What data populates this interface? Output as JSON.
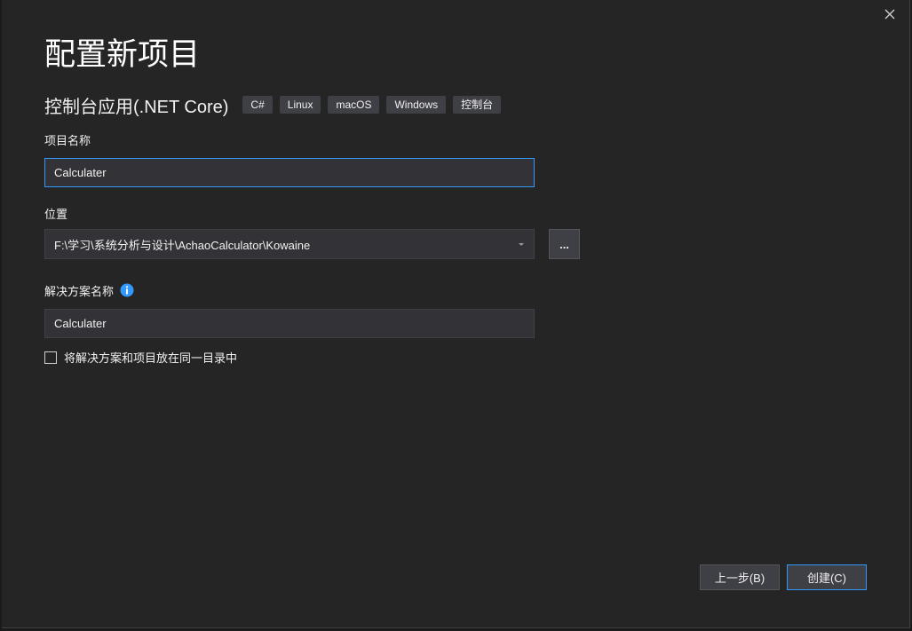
{
  "dialog": {
    "title": "配置新项目",
    "template_name": "控制台应用(.NET Core)",
    "tags": [
      "C#",
      "Linux",
      "macOS",
      "Windows",
      "控制台"
    ]
  },
  "project_name": {
    "label": "项目名称",
    "value": "Calculater"
  },
  "location": {
    "label": "位置",
    "value": "F:\\学习\\系统分析与设计\\AchaoCalculator\\Kowaine",
    "browse_label": "..."
  },
  "solution_name": {
    "label": "解决方案名称",
    "value": "Calculater"
  },
  "same_directory": {
    "label": "将解决方案和项目放在同一目录中",
    "checked": false
  },
  "buttons": {
    "back_label": "上一步(B)",
    "create_label": "创建(C)"
  },
  "colors": {
    "background": "#252526",
    "input_background": "#333337",
    "accent": "#3399ff",
    "info_icon": "#3399ff"
  }
}
